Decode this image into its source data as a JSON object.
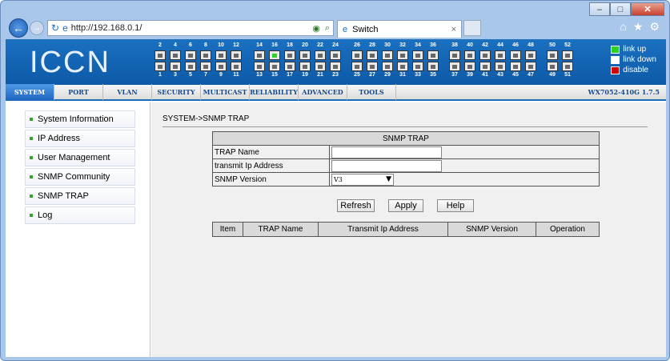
{
  "browser": {
    "url": "http://192.168.0.1/",
    "tab_title": "Switch"
  },
  "brand": {
    "logo": "ICCN"
  },
  "ports": {
    "top_nums": [
      "2",
      "4",
      "6",
      "8",
      "10",
      "12",
      "14",
      "16",
      "18",
      "20",
      "22",
      "24",
      "26",
      "28",
      "30",
      "32",
      "34",
      "36",
      "38",
      "40",
      "42",
      "44",
      "46",
      "48",
      "50",
      "52"
    ],
    "bottom_nums": [
      "1",
      "3",
      "5",
      "7",
      "9",
      "11",
      "13",
      "15",
      "17",
      "19",
      "21",
      "23",
      "25",
      "27",
      "29",
      "31",
      "33",
      "35",
      "37",
      "39",
      "41",
      "43",
      "45",
      "47",
      "49",
      "51"
    ],
    "up_port": "16"
  },
  "legend": {
    "up": "link up",
    "down": "link down",
    "disable": "disable",
    "colors": {
      "up": "#2bd12b",
      "down": "#ffffff",
      "disable": "#d40000"
    }
  },
  "menu": {
    "items": [
      "SYSTEM",
      "PORT",
      "VLAN",
      "SECURITY",
      "MULTICAST",
      "RELIABILITY",
      "ADVANCED",
      "TOOLS"
    ],
    "version": "WX7052-410G 1.7.5"
  },
  "sidebar": {
    "items": [
      "System Information",
      "IP Address",
      "User Management",
      "SNMP Community",
      "SNMP TRAP",
      "Log"
    ]
  },
  "page": {
    "breadcrumb": "SYSTEM->SNMP TRAP"
  },
  "form": {
    "header": "SNMP TRAP",
    "trap_name_label": "TRAP Name",
    "trap_name_value": "",
    "ip_label": "transmit Ip Address",
    "ip_value": "",
    "version_label": "SNMP Version",
    "version_value": "V3"
  },
  "buttons": {
    "refresh": "Refresh",
    "apply": "Apply",
    "help": "Help"
  },
  "list": {
    "columns": [
      "Item",
      "TRAP Name",
      "Transmit Ip Address",
      "SNMP Version",
      "Operation"
    ]
  }
}
